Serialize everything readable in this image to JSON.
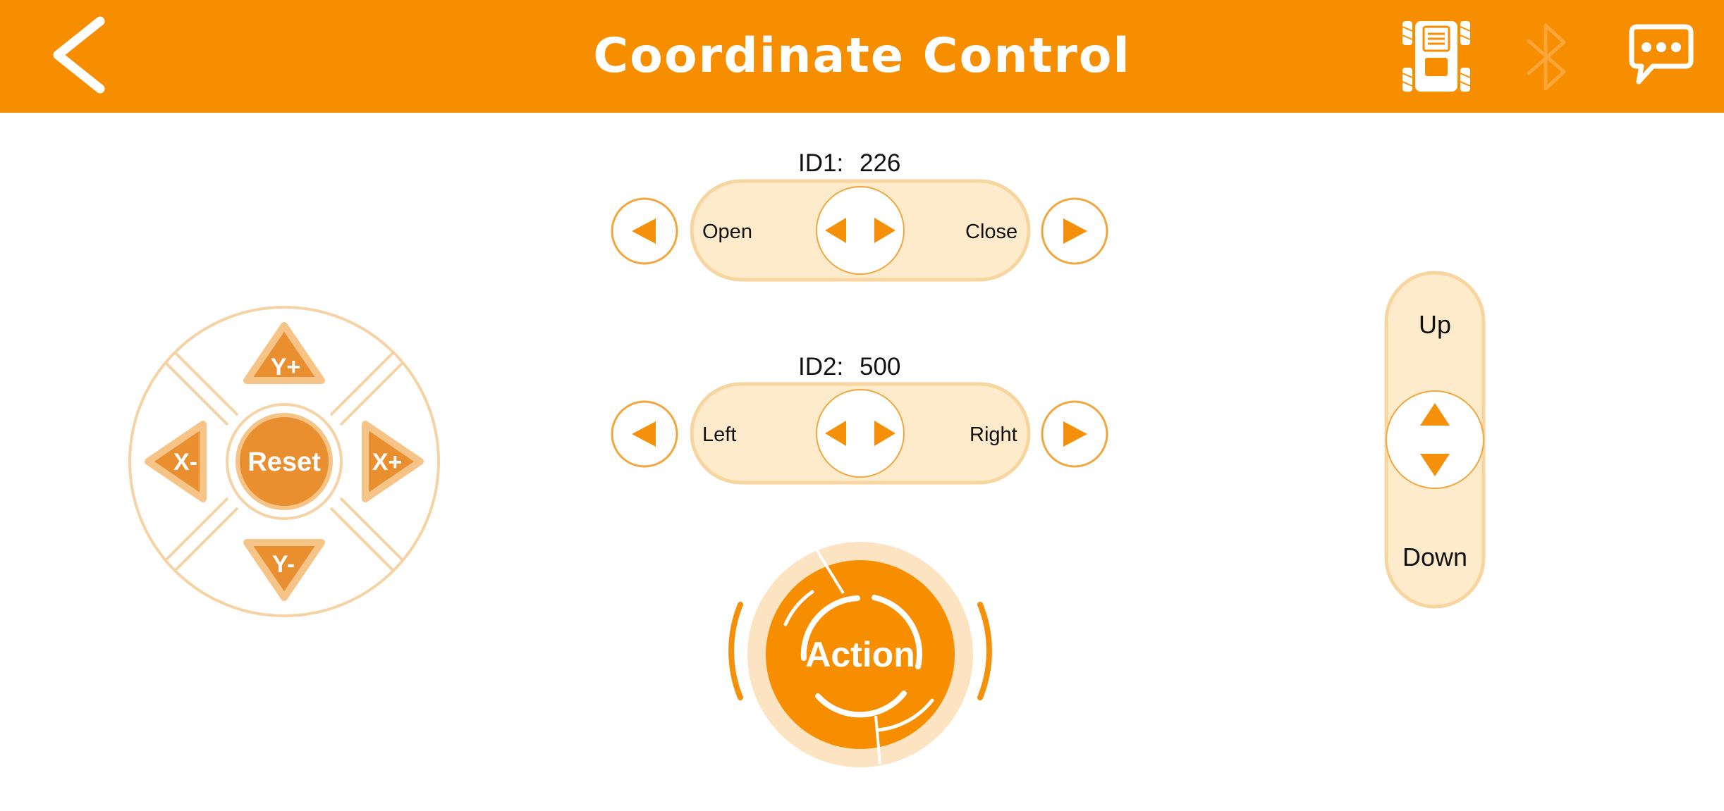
{
  "header": {
    "title": "Coordinate Control",
    "back_icon": "chevron-left-icon",
    "robot_icon": "robot-car-icon",
    "bluetooth_icon": "bluetooth-icon",
    "chat_icon": "chat-bubble-icon"
  },
  "dpad": {
    "up_label": "Y+",
    "down_label": "Y-",
    "left_label": "X-",
    "right_label": "X+",
    "center_label": "Reset"
  },
  "servo1": {
    "id_label": "ID1:",
    "value": "226",
    "left_label": "Open",
    "right_label": "Close"
  },
  "servo2": {
    "id_label": "ID2:",
    "value": "500",
    "left_label": "Left",
    "right_label": "Right"
  },
  "action": {
    "label": "Action"
  },
  "vertical": {
    "up_label": "Up",
    "down_label": "Down"
  },
  "colors": {
    "header": "#F78E00",
    "accent": "#F5900A",
    "dpad_fill": "#EA8F2F",
    "pale": "#FDEBCB",
    "border": "#F2C98E"
  }
}
